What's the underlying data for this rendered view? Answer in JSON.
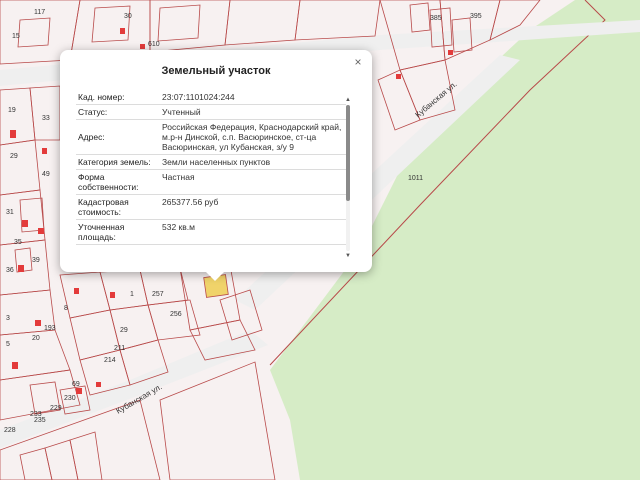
{
  "popup": {
    "title": "Земельный участок",
    "close_icon": "×",
    "rows": [
      {
        "label": "Кад. номер:",
        "value": "23:07:1101024:244"
      },
      {
        "label": "Статус:",
        "value": "Учтенный"
      },
      {
        "label": "Адрес:",
        "value": "Российская Федерация, Краснодарский край, м.р-н Динской, с.п. Васюринское, ст-ца Васюринская, ул Кубанская, з/у 9"
      },
      {
        "label": "Категория земель:",
        "value": "Земли населенных пунктов"
      },
      {
        "label": "Форма собственности:",
        "value": "Частная"
      },
      {
        "label": "Кадастровая стоимость:",
        "value": "265377.56 руб"
      },
      {
        "label": "Уточненная площадь:",
        "value": "532 кв.м"
      }
    ],
    "scroll_position": 0.0
  },
  "map": {
    "street_labels": [
      "Кубанская ул.",
      "Кубанская ул."
    ],
    "parcel_labels": [
      "1011",
      "117",
      "385",
      "395",
      "30",
      "610",
      "15",
      "19",
      "33",
      "29",
      "49",
      "35",
      "39",
      "31",
      "36",
      "8",
      "3",
      "5",
      "193",
      "20",
      "29",
      "256",
      "257",
      "211",
      "214",
      "233",
      "228",
      "235",
      "229",
      "230",
      "69",
      "1"
    ],
    "colors": {
      "map_background": "#f7f1f1",
      "green_area": "#d6ecc6",
      "parcel_line": "#b84a4a",
      "road": "#efefef",
      "red_marker": "#e33b3b",
      "highlight": "#f0d36a"
    }
  }
}
